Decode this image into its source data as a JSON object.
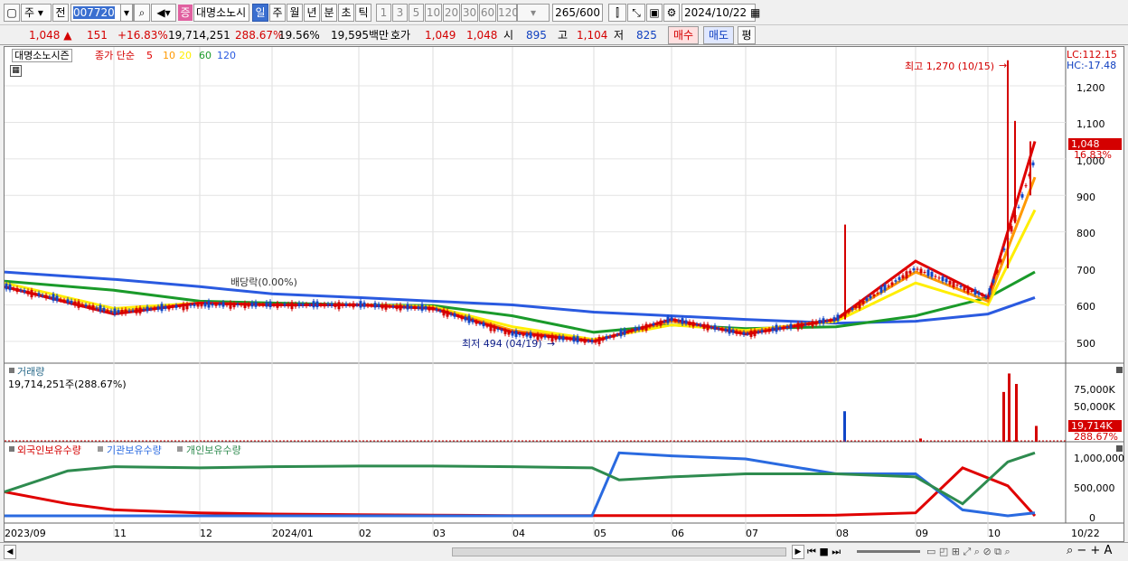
{
  "toolbar1": {
    "market_label": "주",
    "prev_label": "전",
    "code": "007720",
    "name_badge": "증",
    "name": "대명소노시",
    "periods": [
      "일",
      "주",
      "월",
      "년",
      "분",
      "초",
      "틱"
    ],
    "active_period": "일",
    "intervals": [
      "1",
      "3",
      "5",
      "10",
      "20",
      "30",
      "60",
      "120"
    ],
    "count": "265",
    "count_total": "/600",
    "date": "2024/10/22"
  },
  "toolbar2": {
    "price": "1,048",
    "change_arrow": "▲",
    "change": "151",
    "change_pct": "+16.83%",
    "volume": "19,714,251",
    "volume_ratio": "288.67%",
    "turnover": "19.56%",
    "amount": "19,595백만",
    "quote_label": "호가",
    "ask": "1,049",
    "bid": "1,048",
    "open_label": "시",
    "open": "895",
    "high_label": "고",
    "high": "1,104",
    "low_label": "저",
    "low": "825",
    "buy_label": "매수",
    "sell_label": "매도",
    "eval_label": "평"
  },
  "price_panel": {
    "stock_label": "대명소노시즌",
    "ma_label": "종가 단순",
    "ma_periods": [
      "5",
      "10",
      "20",
      "60",
      "120"
    ],
    "lc_label": "LC:112.15",
    "hc_label": "HC:-17.48",
    "current_price": "1,048",
    "current_pct": "16.83%",
    "high_annotation": "최고 1,270 (10/15)",
    "low_annotation": "최저 494 (04/19)",
    "dividend_annotation": "배당락(0.00%)",
    "y_ticks": [
      "1,200",
      "1,100",
      "1,000",
      "900",
      "800",
      "700",
      "600",
      "500"
    ]
  },
  "volume_panel": {
    "title": "거래량",
    "value": "19,714,251주(288.67%)",
    "y_ticks": [
      "75,000K",
      "50,000K"
    ],
    "current": "19,714K",
    "current_pct": "288.67%"
  },
  "holdings_panel": {
    "legend": [
      "외국인보유수량",
      "기관보유수량",
      "개인보유수량"
    ],
    "y_ticks": [
      "1,000,000",
      "500,000",
      "0"
    ]
  },
  "x_axis_labels": [
    "2023/09",
    "11",
    "12",
    "2024/01",
    "02",
    "03",
    "04",
    "05",
    "06",
    "07",
    "08",
    "09",
    "10",
    "10/22"
  ],
  "colors": {
    "up": "#d40000",
    "down": "#1046c8",
    "ma5": "#e00000",
    "ma10": "#ff9900",
    "ma20": "#ffee00",
    "ma60": "#1a9a2a",
    "ma120": "#2a5ae0",
    "foreign": "#e00000",
    "institution": "#2a6ae0",
    "individual": "#2e8b4f"
  },
  "chart_data": [
    {
      "type": "line",
      "title": "대명소노시즌",
      "x": [
        "2023/09",
        "11",
        "12",
        "2024/01",
        "02",
        "03",
        "04",
        "05",
        "06",
        "07",
        "08",
        "09",
        "10",
        "10/22"
      ],
      "series": [
        {
          "name": "종가",
          "values": [
            650,
            580,
            600,
            600,
            600,
            590,
            520,
            500,
            560,
            520,
            560,
            700,
            620,
            1000
          ]
        },
        {
          "name": "5",
          "values": [
            650,
            575,
            605,
            600,
            600,
            590,
            525,
            500,
            560,
            520,
            560,
            720,
            620,
            1048
          ]
        },
        {
          "name": "10",
          "values": [
            650,
            580,
            605,
            600,
            600,
            592,
            530,
            502,
            555,
            525,
            560,
            690,
            610,
            950
          ]
        },
        {
          "name": "20",
          "values": [
            660,
            590,
            605,
            600,
            600,
            595,
            540,
            505,
            545,
            530,
            555,
            660,
            600,
            860
          ]
        },
        {
          "name": "60",
          "values": [
            665,
            640,
            610,
            605,
            600,
            598,
            570,
            525,
            545,
            535,
            540,
            570,
            620,
            690
          ]
        },
        {
          "name": "120",
          "values": [
            690,
            670,
            650,
            630,
            620,
            610,
            600,
            580,
            570,
            560,
            550,
            555,
            575,
            620
          ]
        }
      ],
      "ylim": [
        450,
        1300
      ]
    },
    {
      "type": "bar",
      "title": "거래량",
      "x": [
        "08",
        "09",
        "10a",
        "10b",
        "10c",
        "10/22"
      ],
      "series": [
        {
          "name": "거래량",
          "values": [
            38000,
            4000,
            62000,
            85000,
            72000,
            19714
          ]
        }
      ],
      "ylim": [
        0,
        90000
      ]
    },
    {
      "type": "line",
      "x": [
        "2023/09",
        "10",
        "11",
        "12",
        "2024/01",
        "02",
        "03",
        "04",
        "05a",
        "05b",
        "06",
        "07",
        "08",
        "09",
        "10a",
        "10b",
        "10/22"
      ],
      "series": [
        {
          "name": "외국인보유수량",
          "values": [
            400000,
            200000,
            100000,
            50000,
            30000,
            20000,
            10000,
            5000,
            5000,
            5000,
            5000,
            5000,
            10000,
            50000,
            800000,
            500000,
            0
          ]
        },
        {
          "name": "기관보유수량",
          "values": [
            0,
            0,
            0,
            0,
            0,
            0,
            0,
            0,
            0,
            1050000,
            1000000,
            950000,
            700000,
            700000,
            100000,
            0,
            50000
          ]
        },
        {
          "name": "개인보유수량",
          "values": [
            400000,
            750000,
            820000,
            800000,
            820000,
            830000,
            830000,
            820000,
            800000,
            600000,
            650000,
            700000,
            700000,
            650000,
            200000,
            900000,
            1050000
          ]
        }
      ],
      "ylim": [
        0,
        1100000
      ]
    }
  ]
}
